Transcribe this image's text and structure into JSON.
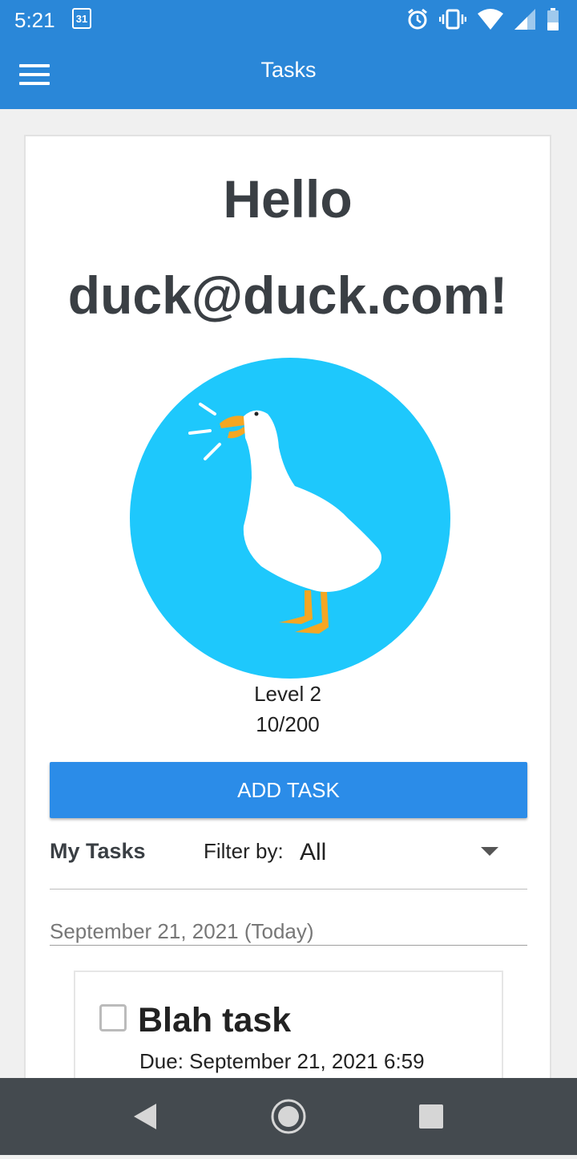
{
  "status_bar": {
    "time": "5:21",
    "calendar_day": "31"
  },
  "app_bar": {
    "title": "Tasks"
  },
  "profile": {
    "greeting": "Hello",
    "email": "duck@duck.com!",
    "level": "Level 2",
    "xp": "10/200"
  },
  "actions": {
    "add_task_label": "ADD TASK"
  },
  "tasks_header": {
    "title": "My Tasks",
    "filter_label": "Filter by:",
    "filter_value": "All"
  },
  "task_groups": [
    {
      "date": "September 21, 2021 (Today)",
      "tasks": [
        {
          "title": "Blah task",
          "due": "Due: September 21, 2021 6:59",
          "checked": false
        }
      ]
    }
  ],
  "colors": {
    "primary": "#2a87d8",
    "button": "#2b8ce8",
    "avatar_bg": "#1ec8fc",
    "nav_bar": "#444a4f"
  },
  "icons": [
    "calendar-icon",
    "alarm-icon",
    "vibrate-icon",
    "wifi-icon",
    "signal-icon",
    "battery-icon",
    "menu-icon",
    "goose-avatar",
    "back-icon",
    "home-icon",
    "recents-icon"
  ]
}
